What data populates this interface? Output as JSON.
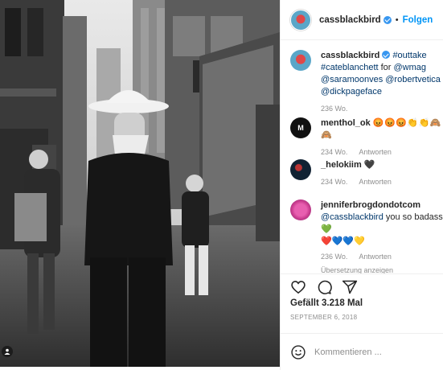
{
  "post": {
    "author": "cassblackbird",
    "follow_label": "Folgen",
    "dot": "•"
  },
  "caption": {
    "user": "cassblackbird",
    "text_parts": [
      "#outtake",
      " #cateblanchett",
      " for ",
      "@wmag",
      " @saramoonves",
      " @robertvetica",
      " @dickpageface"
    ],
    "time": "236 Wo."
  },
  "comments": [
    {
      "user": "menthol_ok",
      "text": "😡😡😡👏👏🙈🙈",
      "time": "234 Wo.",
      "reply": "Antworten"
    },
    {
      "user": "_helokiim",
      "text": "🖤",
      "time": "234 Wo.",
      "reply": "Antworten"
    },
    {
      "user": "jenniferbrogdondotcom",
      "mention": "@cassblackbird",
      "text": " you so badass 💚",
      "text2": "❤️💙💙💛",
      "time": "236 Wo.",
      "reply": "Antworten",
      "translate": "Übersetzung anzeigen"
    }
  ],
  "engagement": {
    "likes": "Gefällt 3.218 Mal",
    "date": "SEPTEMBER 6, 2018"
  },
  "comment_box": {
    "placeholder": "Kommentieren ..."
  },
  "icons": [
    "heart-icon",
    "comment-icon",
    "share-icon",
    "emoji-icon",
    "user-tag-icon",
    "verified-icon"
  ],
  "colors": {
    "link": "#0095f6",
    "mention": "#00376b",
    "muted": "#8e8e8e",
    "border": "#efefef"
  }
}
